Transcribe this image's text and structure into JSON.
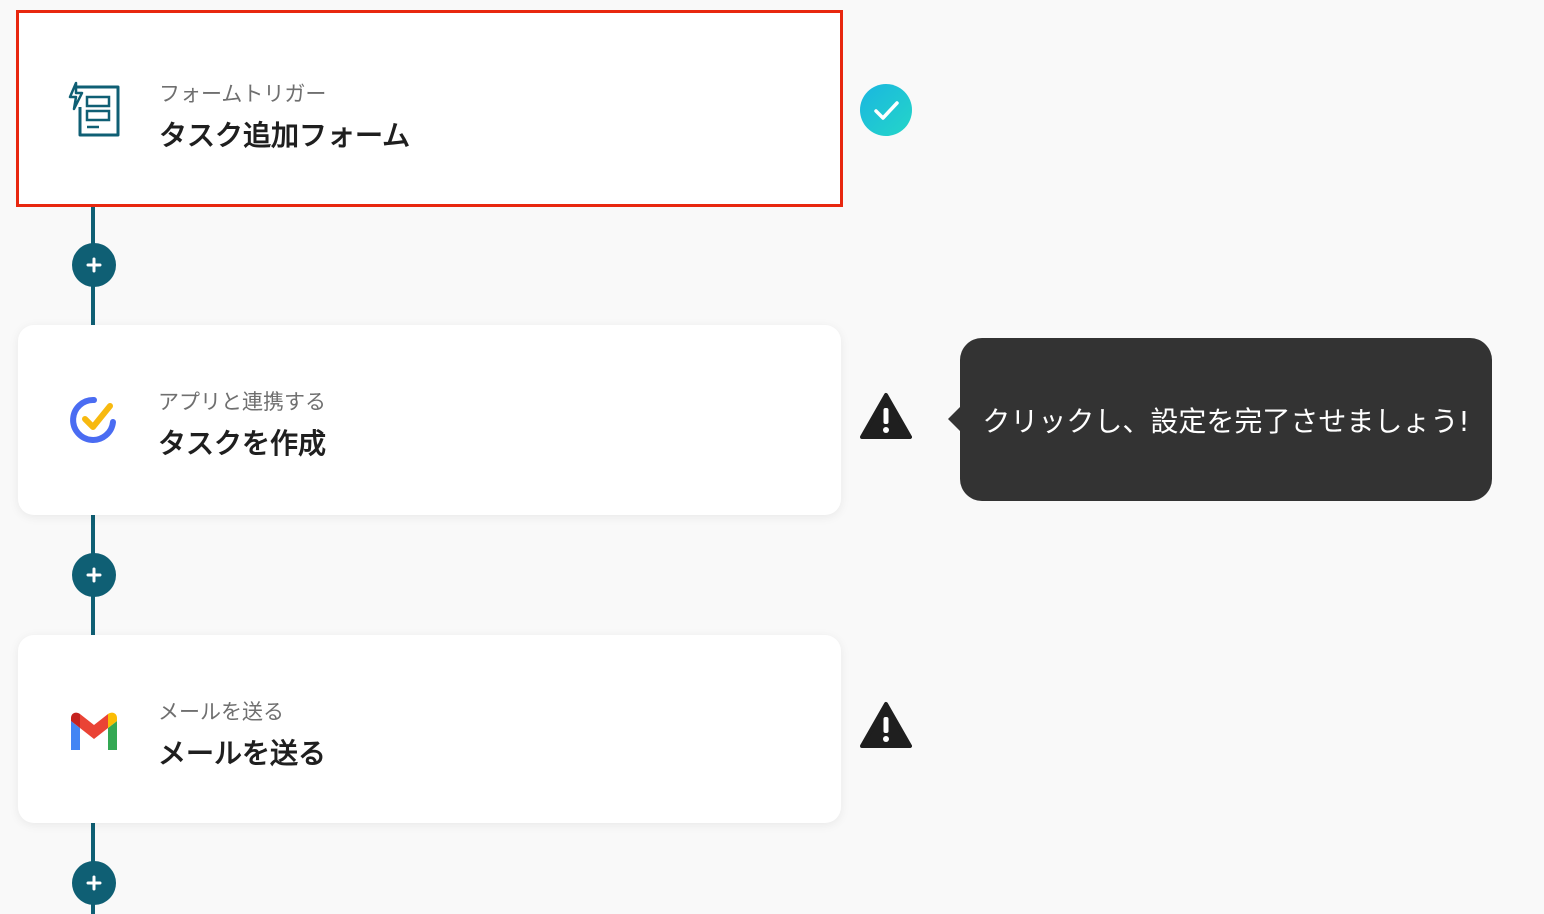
{
  "steps": [
    {
      "subtitle": "フォームトリガー",
      "title": "タスク追加フォーム",
      "icon": "form-trigger-icon",
      "status": "complete",
      "selected": true
    },
    {
      "subtitle": "アプリと連携する",
      "title": "タスクを作成",
      "icon": "ticktick-icon",
      "status": "warning",
      "selected": false
    },
    {
      "subtitle": "メールを送る",
      "title": "メールを送る",
      "icon": "gmail-icon",
      "status": "warning",
      "selected": false
    }
  ],
  "tooltip": {
    "text": "クリックし、設定を完了させましょう!"
  },
  "colors": {
    "connector": "#0f5f74",
    "selected_border": "#e8270f",
    "complete": "#1bc4dc",
    "warning": "#1f1f1f",
    "tooltip_bg": "#333333",
    "background": "#f9f9f9"
  }
}
